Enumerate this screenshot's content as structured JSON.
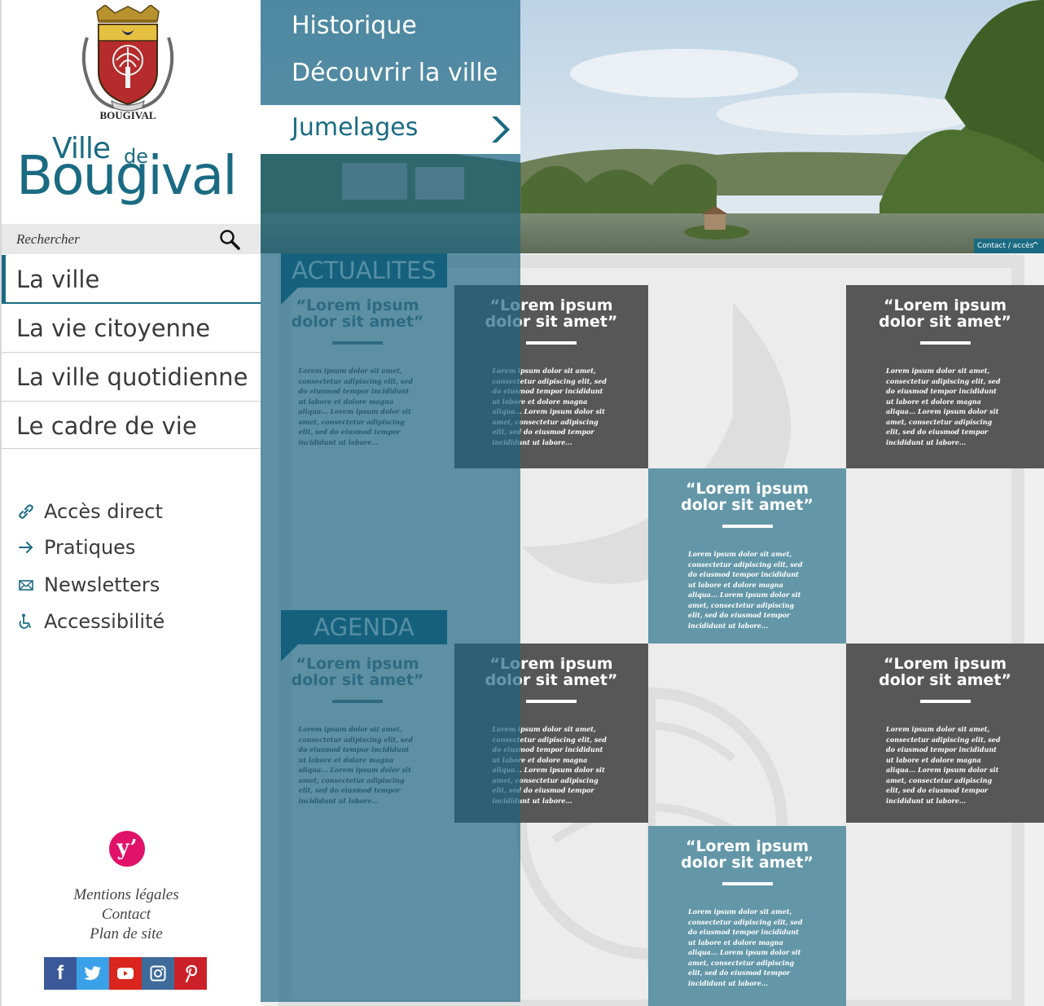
{
  "sidebar": {
    "crest_caption": "BOUGIVAL",
    "logo": {
      "line1": "Ville",
      "line1_suffix": "de",
      "line2": "Bougival"
    },
    "search": {
      "placeholder": "Rechercher"
    },
    "menu": [
      {
        "label": "La ville",
        "active": true
      },
      {
        "label": "La vie citoyenne",
        "active": false
      },
      {
        "label": "La ville quotidienne",
        "active": false
      },
      {
        "label": "Le cadre de vie",
        "active": false
      }
    ],
    "quick_links": [
      {
        "icon": "link-icon",
        "label": "Accès direct"
      },
      {
        "icon": "arrow-right-icon",
        "label": "Pratiques"
      },
      {
        "icon": "envelope-icon",
        "label": "Newsletters"
      },
      {
        "icon": "wheelchair-icon",
        "label": "Accessibilité"
      }
    ],
    "footer_links": [
      "Mentions légales",
      "Contact",
      "Plan de site"
    ],
    "social": [
      {
        "icon": "facebook-icon",
        "color": "#3b5998"
      },
      {
        "icon": "twitter-icon",
        "color": "#3aa1e8"
      },
      {
        "icon": "youtube-icon",
        "color": "#d9251d"
      },
      {
        "icon": "instagram-icon",
        "color": "#3d6b9a"
      },
      {
        "icon": "pinterest-icon",
        "color": "#cb2027"
      }
    ]
  },
  "submenu": {
    "items": [
      "Historique",
      "Découvrir la ville"
    ],
    "active_item": "Jumelages"
  },
  "header": {
    "contact_tab": "Contact / accès"
  },
  "sections": {
    "actualites": "ACTUALITES",
    "agenda": "AGENDA"
  },
  "card": {
    "title": "“Lorem ipsum dolor sit amet”",
    "text": "Lorem ipsum dolor sit amet, consectetur adipiscing elit, sed do eiusmod tempor incididunt ut labore et dolore magna aliqua... Lorem ipsum dolor sit amet, consectetur adipiscing elit, sed do eiusmod tempor incididunt ut labore..."
  },
  "colors": {
    "brand": "#1a6b82",
    "card_dark": "#575757",
    "card_teal": "#6397a8",
    "section_tag": "#0f5c77",
    "yvelines_pink": "#e0126a"
  }
}
